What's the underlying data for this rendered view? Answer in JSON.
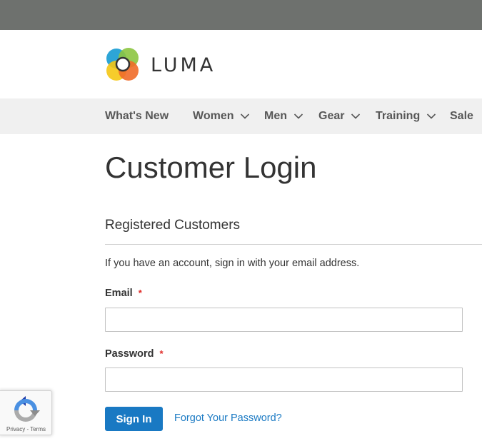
{
  "brand": {
    "name": "LUMA",
    "icon": "luma-logo-icon"
  },
  "nav": {
    "items": [
      {
        "label": "What's New",
        "has_dropdown": false
      },
      {
        "label": "Women",
        "has_dropdown": true
      },
      {
        "label": "Men",
        "has_dropdown": true
      },
      {
        "label": "Gear",
        "has_dropdown": true
      },
      {
        "label": "Training",
        "has_dropdown": true
      },
      {
        "label": "Sale",
        "has_dropdown": false
      }
    ]
  },
  "page": {
    "title": "Customer Login"
  },
  "login": {
    "section_title": "Registered Customers",
    "intro": "If you have an account, sign in with your email address.",
    "email_label": "Email",
    "email_value": "",
    "password_label": "Password",
    "password_value": "",
    "required_mark": "*",
    "signin_label": "Sign In",
    "forgot_label": "Forgot Your Password?"
  },
  "recaptcha": {
    "privacy": "Privacy",
    "separator": " - ",
    "terms": "Terms"
  },
  "colors": {
    "top_bar": "#6e716e",
    "nav_bg": "#f0f0f0",
    "primary": "#1979c3",
    "required": "#e02b27"
  }
}
